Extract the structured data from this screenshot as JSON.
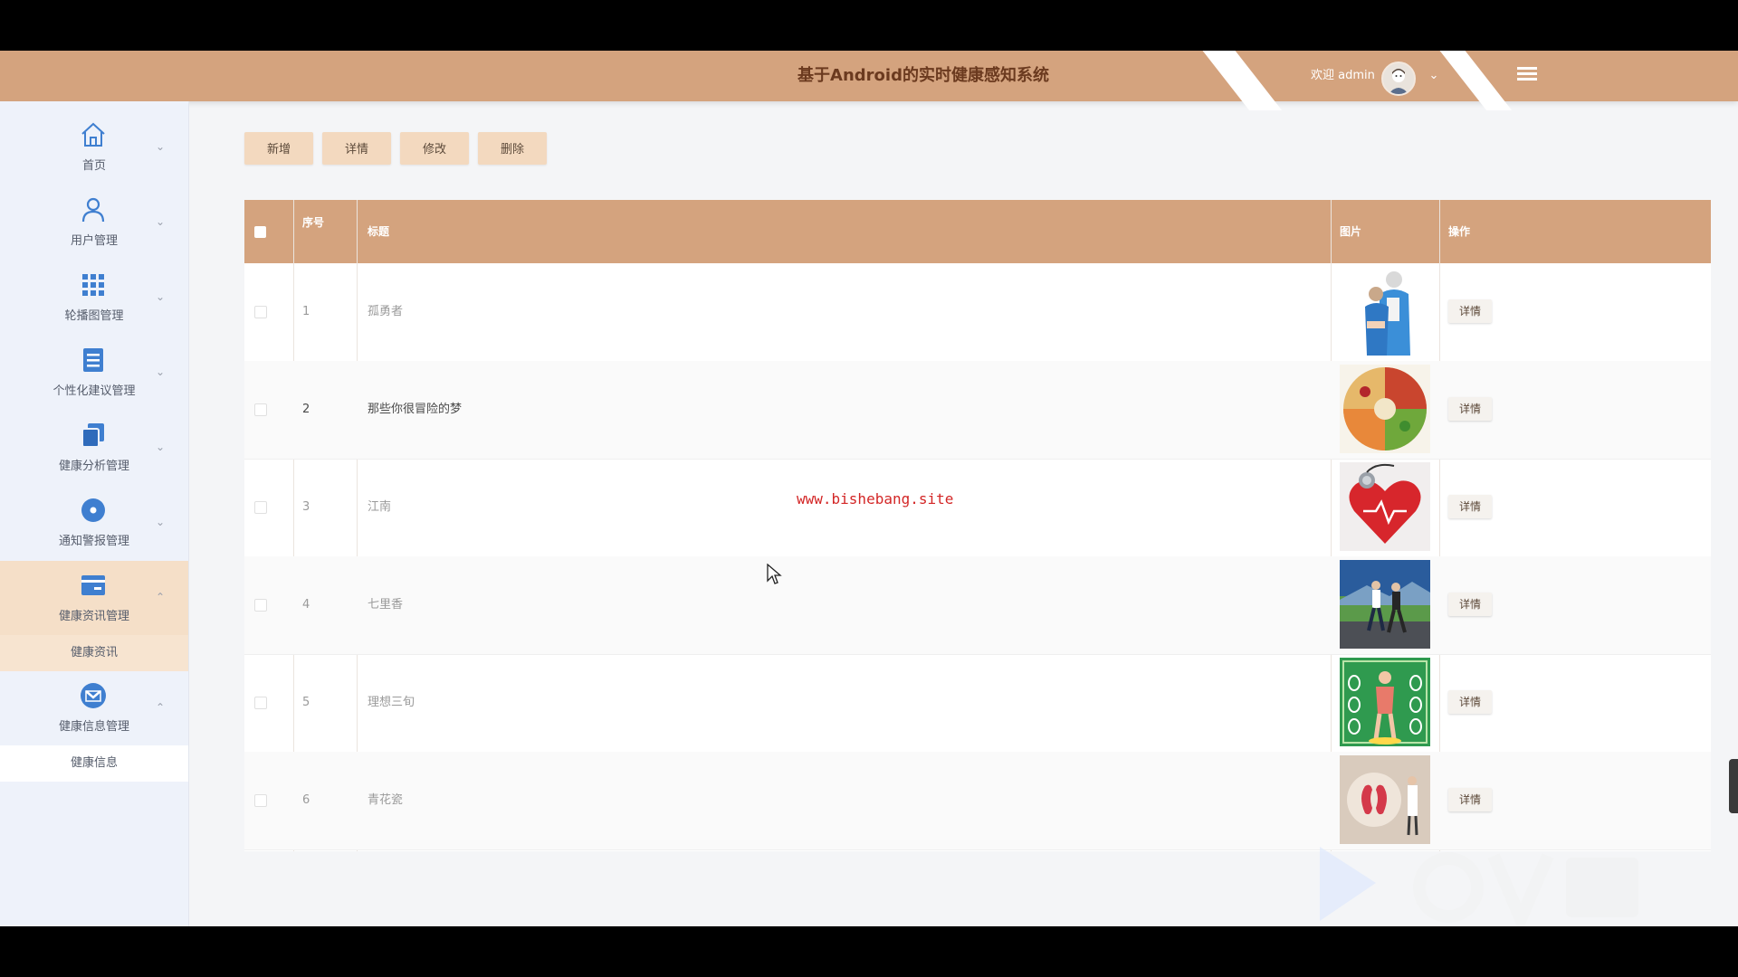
{
  "header": {
    "title": "基于Android的实时健康感知系统",
    "welcome": "欢迎 admin",
    "user_menu_caret": "chevron-down-icon",
    "menu_icon": "hamburger-icon"
  },
  "sidebar": {
    "items": [
      {
        "label": "首页",
        "icon": "home-icon",
        "expanded": false
      },
      {
        "label": "用户管理",
        "icon": "user-icon",
        "expanded": false
      },
      {
        "label": "轮播图管理",
        "icon": "grid-icon",
        "expanded": false
      },
      {
        "label": "个性化建议管理",
        "icon": "database-icon",
        "expanded": false
      },
      {
        "label": "健康分析管理",
        "icon": "copy-icon",
        "expanded": false
      },
      {
        "label": "通知警报管理",
        "icon": "circle-dot-icon",
        "expanded": false
      },
      {
        "label": "健康资讯管理",
        "icon": "card-icon",
        "expanded": true,
        "sub": "健康资讯"
      },
      {
        "label": "健康信息管理",
        "icon": "mail-icon",
        "expanded": true,
        "sub": "健康信息"
      }
    ]
  },
  "toolbar": {
    "add": "新增",
    "detail": "详情",
    "edit": "修改",
    "delete": "删除"
  },
  "table": {
    "columns": {
      "seq": "序号",
      "title": "标题",
      "image": "图片",
      "action": "操作"
    },
    "rows": [
      {
        "seq": "1",
        "title": "孤勇者",
        "action": "详情",
        "image": "photo-elderly-couple"
      },
      {
        "seq": "2",
        "title": "那些你很冒险的梦",
        "action": "详情",
        "image": "photo-fruits-vegetables"
      },
      {
        "seq": "3",
        "title": "江南",
        "action": "详情",
        "image": "photo-heart-stethoscope"
      },
      {
        "seq": "4",
        "title": "七里香",
        "action": "详情",
        "image": "photo-couple-running"
      },
      {
        "seq": "5",
        "title": "理想三旬",
        "action": "详情",
        "image": "photo-body-diagram"
      },
      {
        "seq": "6",
        "title": "青花瓷",
        "action": "详情",
        "image": "photo-kidney-doctor"
      }
    ]
  },
  "watermark": "www.bishebang.site",
  "colors": {
    "accent": "#d4a37e",
    "button": "#f3d9bf",
    "sidebar_bg": "#eef2fa",
    "active_bg": "#f5dfc8",
    "watermark": "#d32626"
  }
}
